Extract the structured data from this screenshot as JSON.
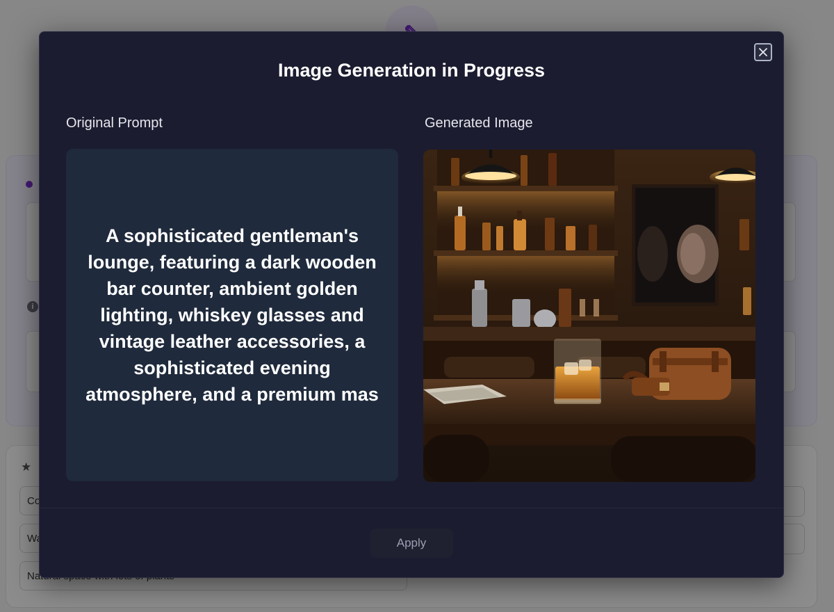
{
  "background": {
    "inputs": [
      "Co",
      "Wa",
      "Natural space with lots of plants"
    ]
  },
  "modal": {
    "title": "Image Generation in Progress",
    "original_prompt_label": "Original Prompt",
    "generated_image_label": "Generated Image",
    "prompt_text": "A sophisticated gentleman's lounge, featuring a dark wooden bar counter, ambient golden lighting, whiskey glasses and vintage leather accessories, a sophisticated evening atmosphere, and a premium mas",
    "apply_label": "Apply",
    "close_icon": "close-icon",
    "generated_image_alt": "gentleman's lounge bar with whiskey glass and leather bag"
  },
  "colors": {
    "modal_bg": "#1b1c2f",
    "prompt_bg": "#1f2a3c",
    "accent": "#7b2fd0"
  }
}
